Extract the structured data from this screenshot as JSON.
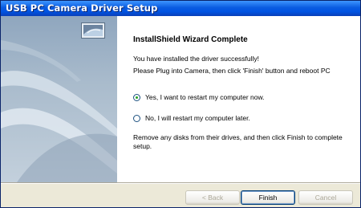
{
  "window": {
    "title": "USB PC Camera Driver Setup"
  },
  "main": {
    "heading": "InstallShield Wizard Complete",
    "installed_msg": "You have installed the driver successfully!",
    "plug_msg": "Please Plug into Camera, then click 'Finish' button and reboot PC",
    "options": [
      {
        "label": "Yes, I want to restart my computer now.",
        "selected": true
      },
      {
        "label": "No, I will restart my computer later.",
        "selected": false
      }
    ],
    "remove_msg": "Remove any disks from their drives, and then click Finish to complete setup."
  },
  "buttons": {
    "back": "< Back",
    "finish": "Finish",
    "cancel": "Cancel"
  },
  "icons": {
    "setup": "monitor-icon",
    "radio_selected": "radio-selected-icon",
    "radio_unselected": "radio-unselected-icon"
  },
  "colors": {
    "titlebar": "#0054E3",
    "panel": "#A9BBCC",
    "dialog_bg": "#ECE9D8",
    "radio_dot": "#21A121"
  }
}
